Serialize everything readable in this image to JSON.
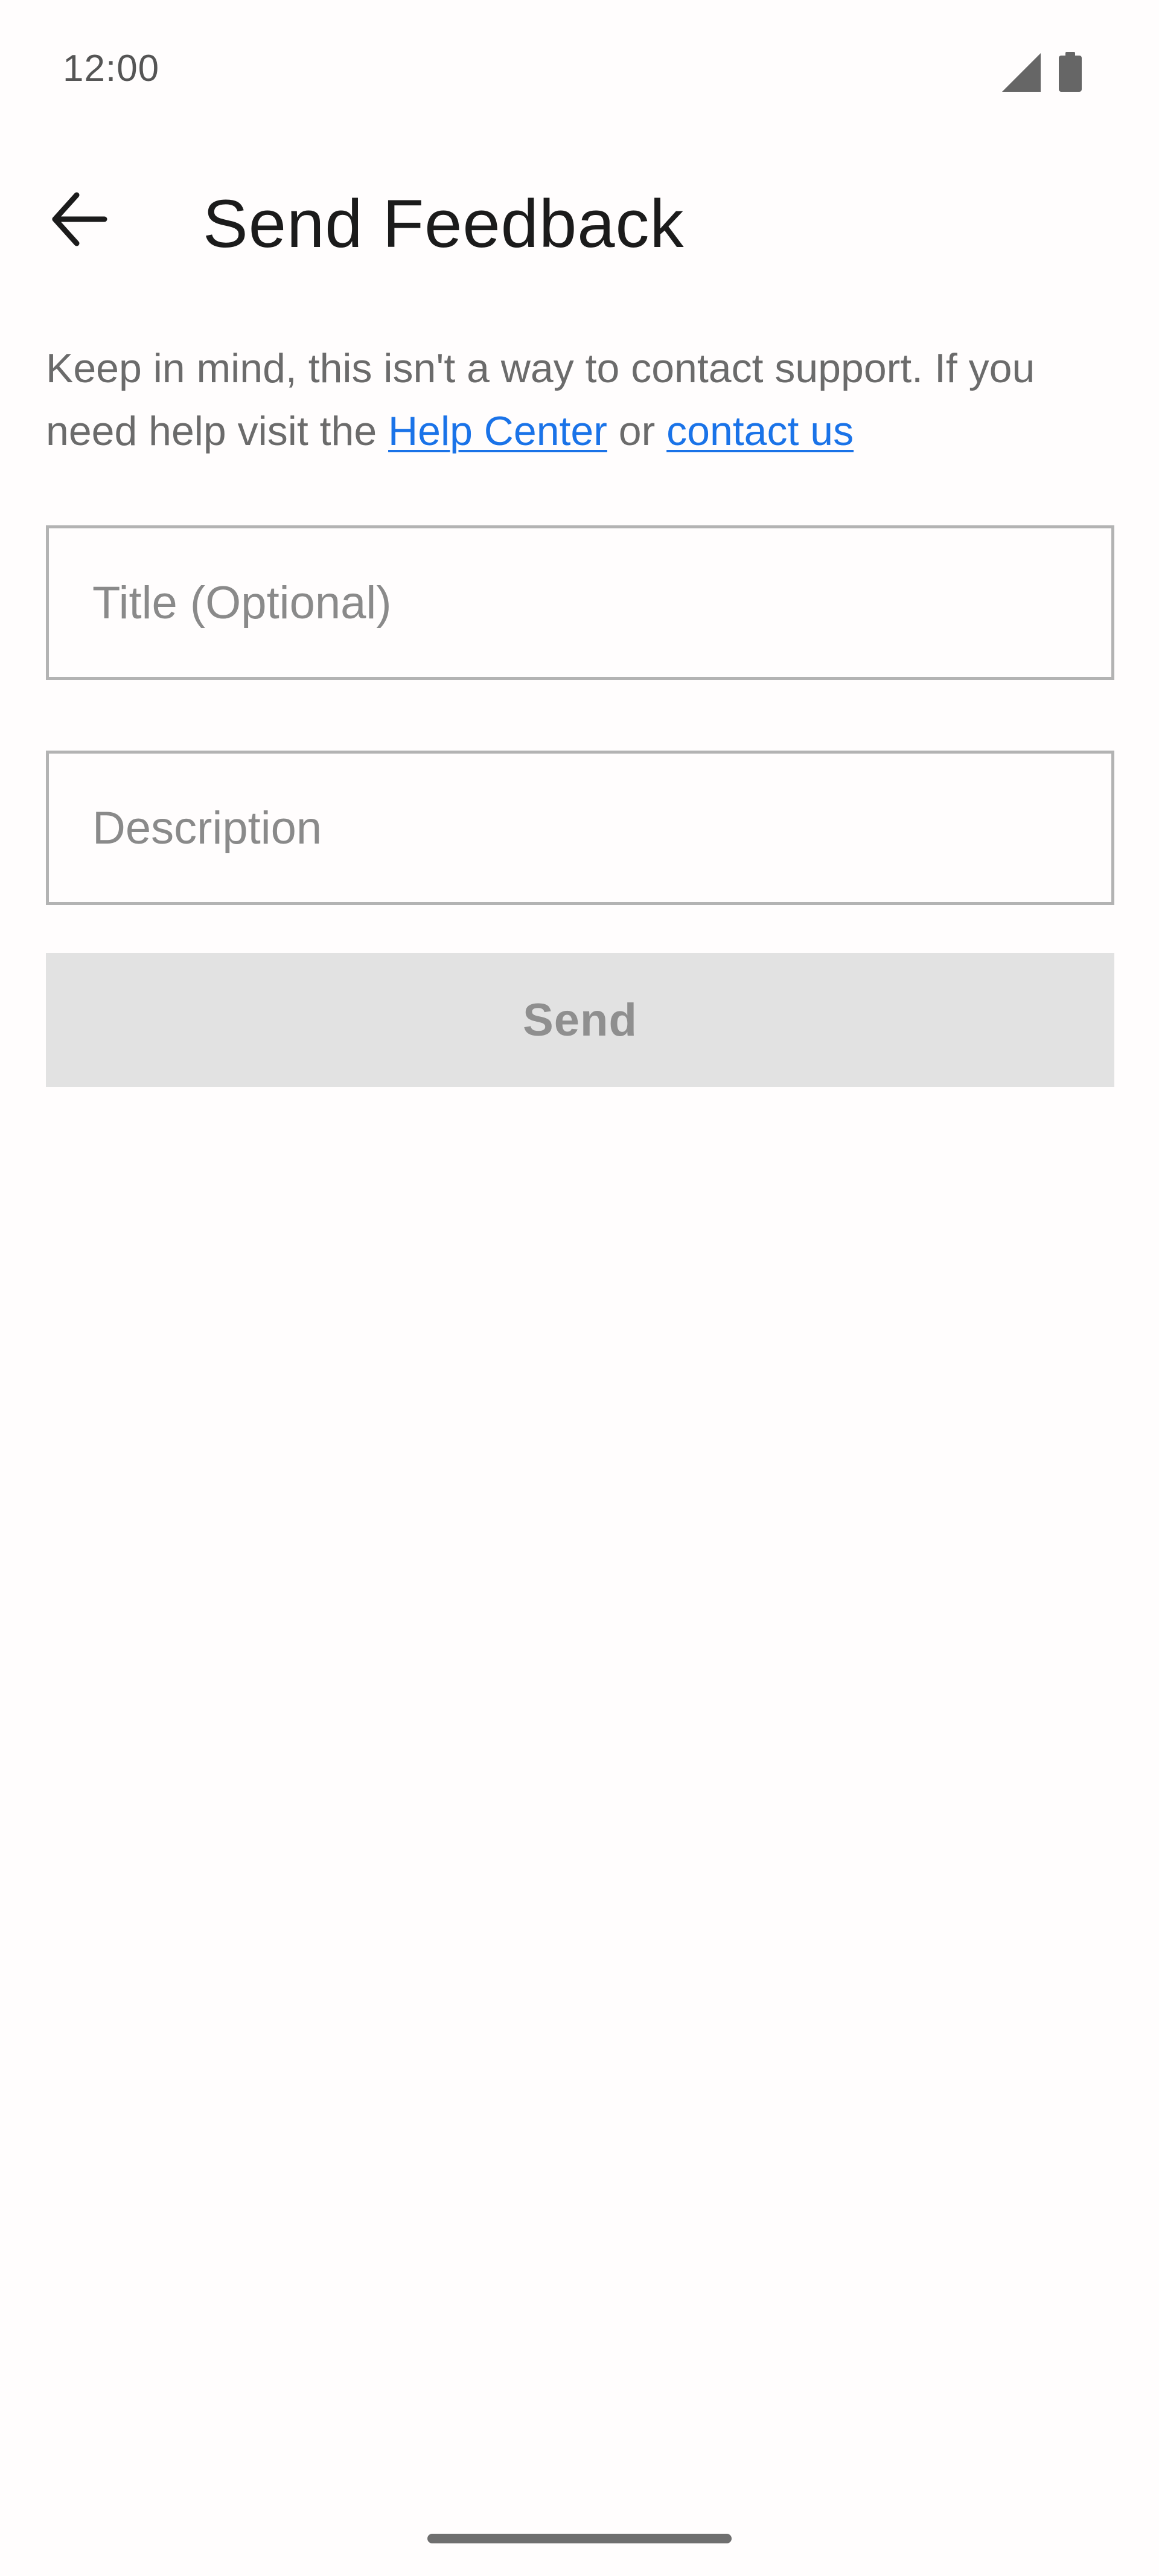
{
  "status_bar": {
    "time": "12:00",
    "icons": [
      "signal-icon",
      "battery-icon"
    ]
  },
  "app_bar": {
    "back_icon": "arrow-back-icon",
    "title": "Send Feedback"
  },
  "info": {
    "text_before": "Keep in mind, this isn't a way to contact support. If you need help visit the ",
    "help_center_link": "Help Center",
    "text_between": " or ",
    "contact_link": "contact us"
  },
  "form": {
    "title_placeholder": "Title (Optional)",
    "title_value": "",
    "description_placeholder": "Description",
    "description_value": "",
    "send_label": "Send",
    "send_enabled": false
  },
  "colors": {
    "background": "#FFFDFD",
    "link": "#1a73e8",
    "body_text": "#6b6b6b",
    "disabled_button_bg": "#e2e2e2",
    "disabled_button_text": "#8f8f8f"
  }
}
